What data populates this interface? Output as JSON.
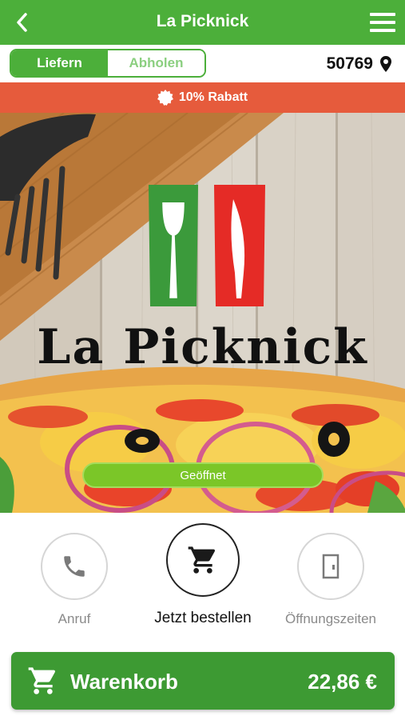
{
  "header": {
    "title": "La Picknick",
    "back_icon": "chevron-left-icon",
    "menu_icon": "hamburger-menu-icon"
  },
  "mode": {
    "options": [
      "Liefern",
      "Abholen"
    ],
    "selected": "Liefern",
    "zip": "50769",
    "zip_icon": "location-pin-icon"
  },
  "promo": {
    "icon": "badge-icon",
    "text": "10% Rabatt"
  },
  "hero": {
    "logo_text": "La Picknick",
    "status": "Geöffnet"
  },
  "actions": [
    {
      "label": "Anruf",
      "icon": "phone-icon"
    },
    {
      "label": "Jetzt bestellen",
      "icon": "cart-icon"
    },
    {
      "label": "Öffnungszeiten",
      "icon": "door-icon"
    }
  ],
  "cart": {
    "label": "Warenkorb",
    "total": "22,86 €",
    "icon": "cart-icon"
  },
  "colors": {
    "primary_green": "#4caf3a",
    "promo_orange": "#e65b3c",
    "status_green": "#7bc628",
    "cart_green": "#3d9a33"
  }
}
